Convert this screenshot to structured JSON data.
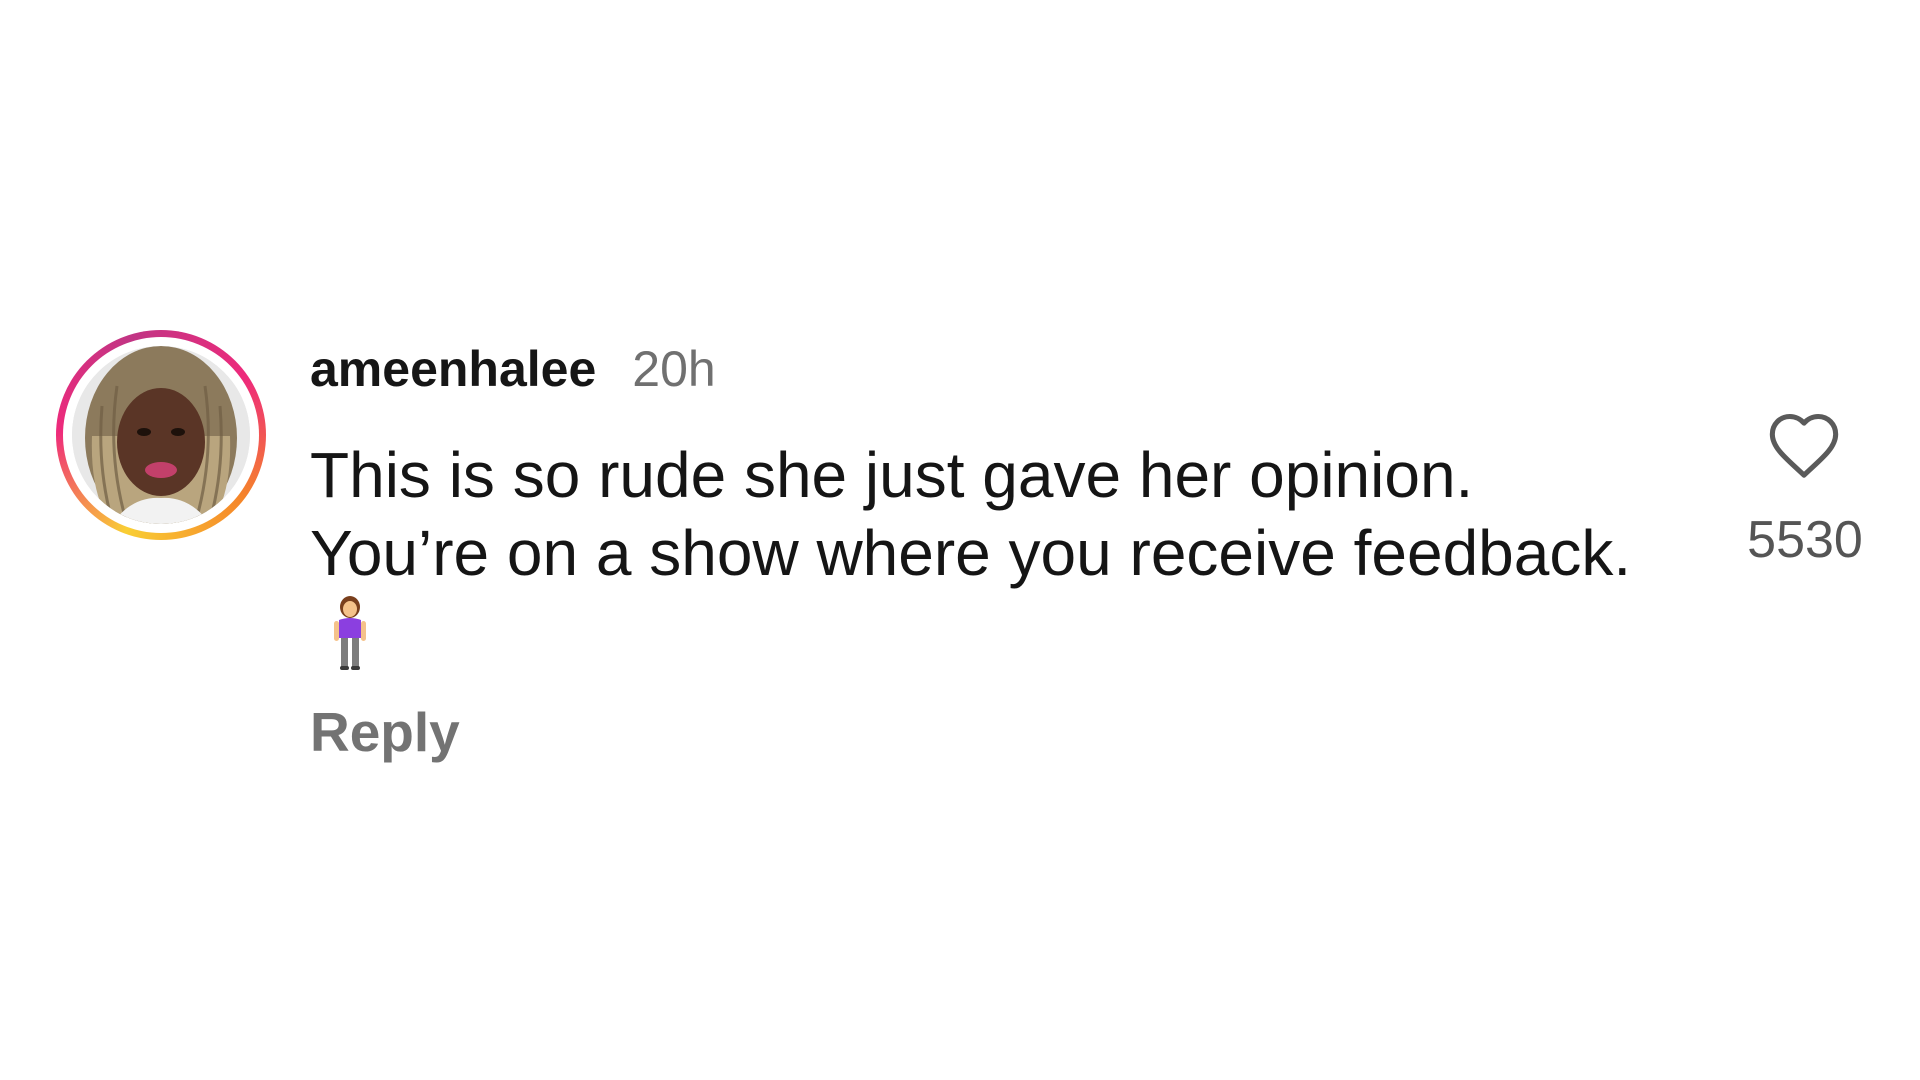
{
  "comment": {
    "username": "ameenhalee",
    "timestamp": "20h",
    "text_lines": [
      "This is so rude she just gave her opinion.",
      "You’re on a show where you receive feedback."
    ],
    "emoji": "woman-standing",
    "reply_label": "Reply",
    "like_count": "5530",
    "liked": false
  },
  "icons": {
    "like": "heart-outline-icon",
    "emoji": "woman-standing-emoji-icon"
  },
  "colors": {
    "background": "#ffffff",
    "username": "#161616",
    "meta_text": "#707070",
    "ring_gradient": [
      "#f9ce34",
      "#ee2a7b",
      "#c13584"
    ]
  }
}
